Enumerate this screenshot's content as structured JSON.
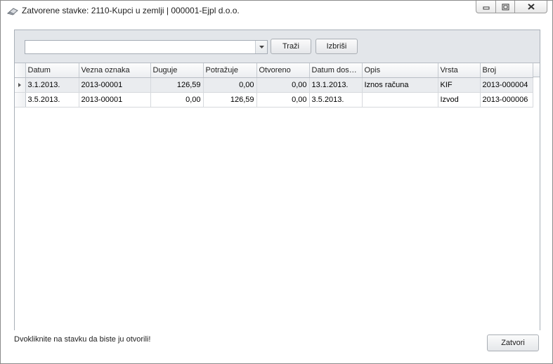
{
  "window": {
    "title": "Zatvorene stavke: 2110-Kupci u zemlji | 000001-Ejpl d.o.o.",
    "app_icon": "eraser-icon",
    "controls": [
      "minimize-icon",
      "maximize-icon",
      "close-icon"
    ]
  },
  "filter": {
    "combo_value": "",
    "search_label": "Traži",
    "clear_label": "Izbriši"
  },
  "grid": {
    "columns": [
      "Datum",
      "Vezna oznaka",
      "Duguje",
      "Potražuje",
      "Otvoreno",
      "Datum dos…",
      "Opis",
      "Vrsta",
      "Broj"
    ],
    "rows": [
      [
        "3.1.2013.",
        "2013-00001",
        "126,59",
        "0,00",
        "0,00",
        "13.1.2013.",
        "Iznos računa",
        "KIF",
        "2013-000004"
      ],
      [
        "3.5.2013.",
        "2013-00001",
        "0,00",
        "126,59",
        "0,00",
        "3.5.2013.",
        "",
        "Izvod",
        "2013-000006"
      ]
    ],
    "selected_row": 0
  },
  "footer": {
    "hint": "Dvokliknite na stavku da biste ju otvorili!",
    "close_label": "Zatvori"
  }
}
